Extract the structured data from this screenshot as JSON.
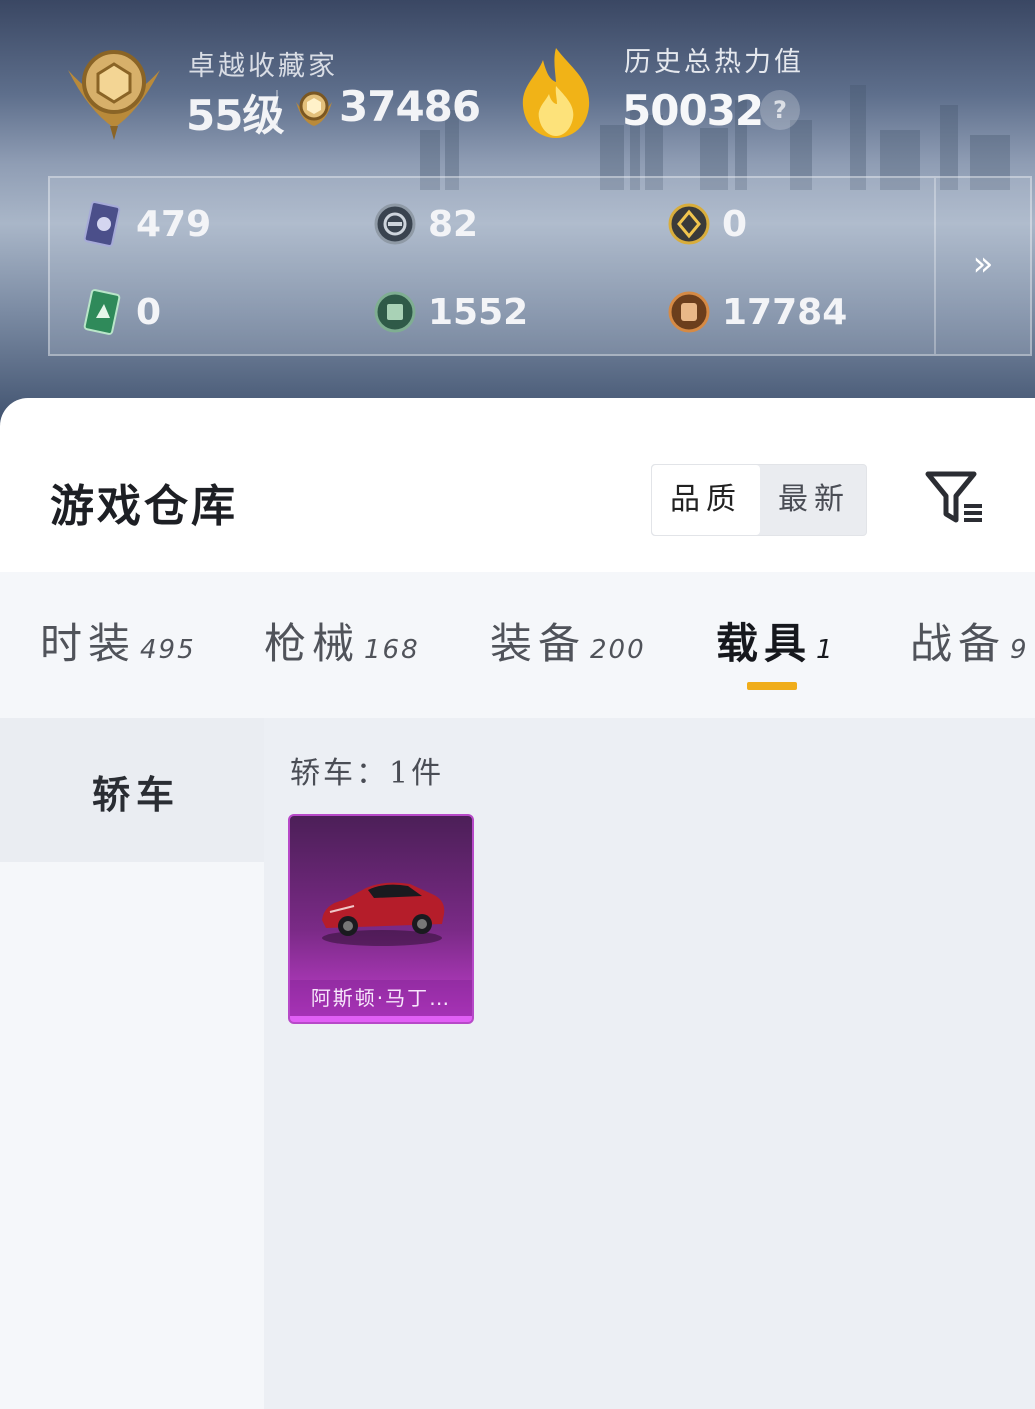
{
  "header": {
    "rank_title": "卓越收藏家",
    "level": "55级",
    "collection_points": "37486",
    "heat_title": "历史总热力值",
    "heat_value": "50032",
    "help_symbol": "?"
  },
  "currencies": [
    {
      "icon": "card-icon",
      "value": "479"
    },
    {
      "icon": "silver-coin-icon",
      "value": "82"
    },
    {
      "icon": "gold-badge-icon",
      "value": "0"
    },
    {
      "icon": "green-card-icon",
      "value": "0"
    },
    {
      "icon": "green-coin-icon",
      "value": "1552"
    },
    {
      "icon": "bronze-coin-icon",
      "value": "17784"
    }
  ],
  "expand_symbol": "»",
  "warehouse": {
    "title": "游戏仓库",
    "sort_options": [
      "品质",
      "最新"
    ],
    "active_sort": "品质"
  },
  "tabs": [
    {
      "label": "时装",
      "count": "495"
    },
    {
      "label": "枪械",
      "count": "168"
    },
    {
      "label": "装备",
      "count": "200"
    },
    {
      "label": "载具",
      "count": "1"
    },
    {
      "label": "战备",
      "count": "9"
    }
  ],
  "active_tab": "载具",
  "sidebar": {
    "items": [
      {
        "label": "轿车"
      }
    ]
  },
  "section": {
    "label": "轿车：1件"
  },
  "items": [
    {
      "name": "阿斯顿·马丁…"
    }
  ],
  "colors": {
    "accent": "#f0ad1a",
    "item_rarity": "#c33fd0"
  }
}
